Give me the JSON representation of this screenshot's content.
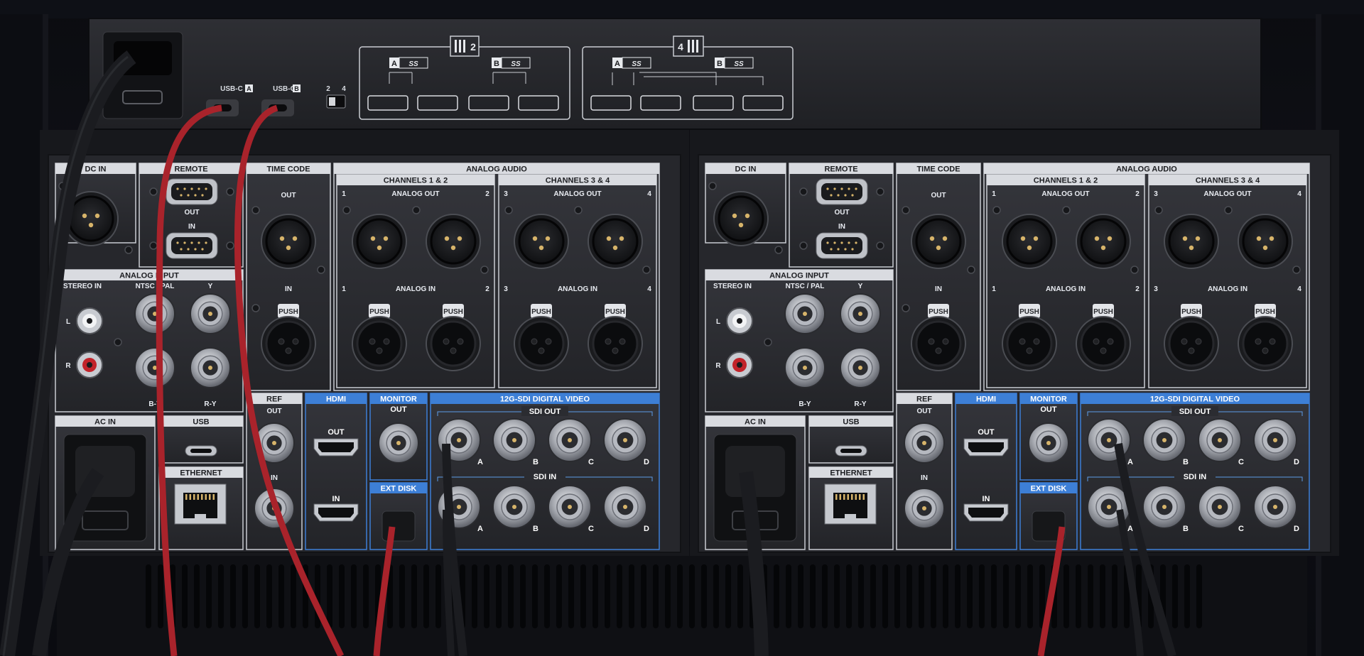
{
  "top_box": {
    "usb_c_a": "USB-C",
    "usb_c_b": "USB-C",
    "badge_a": "A",
    "badge_b": "B",
    "switch_2": "2",
    "switch_4": "4",
    "mode_2_num": "2",
    "mode_4_num": "4",
    "ss_glyph": "SS"
  },
  "unit": {
    "dc_in": "DC IN",
    "remote": "REMOTE",
    "remote_out": "OUT",
    "remote_in": "IN",
    "time_code": "TIME CODE",
    "tc_out": "OUT",
    "tc_in": "IN",
    "analog_audio": "ANALOG AUDIO",
    "ch12": "CHANNELS 1 & 2",
    "ch34": "CHANNELS 3 & 4",
    "analog_out": "ANALOG OUT",
    "analog_in": "ANALOG IN",
    "n1": "1",
    "n2": "2",
    "n3": "3",
    "n4": "4",
    "push": "PUSH",
    "analog_input": "ANALOG INPUT",
    "stereo_in": "STEREO IN",
    "ntsc_pal": "NTSC / PAL",
    "y": "Y",
    "by": "B-Y",
    "ry": "R-Y",
    "l": "L",
    "r": "R",
    "ac_in": "AC IN",
    "usb": "USB",
    "ethernet": "ETHERNET",
    "ref": "REF",
    "ref_out": "OUT",
    "ref_in": "IN",
    "hdmi": "HDMI",
    "hdmi_out": "OUT",
    "hdmi_in": "IN",
    "monitor": "MONITOR",
    "monitor_out": "OUT",
    "ext_disk": "EXT DISK",
    "sdi_title": "12G-SDI DIGITAL VIDEO",
    "sdi_out": "SDI OUT",
    "sdi_in": "SDI IN",
    "a": "A",
    "b": "B",
    "c": "C",
    "d": "D"
  },
  "colors": {
    "accent_blue": "#3d7fd6",
    "cable_red": "#b3262d",
    "cable_black": "#1b1c20",
    "panel": "#2b2c31",
    "label_bg": "#d9dbe0"
  }
}
